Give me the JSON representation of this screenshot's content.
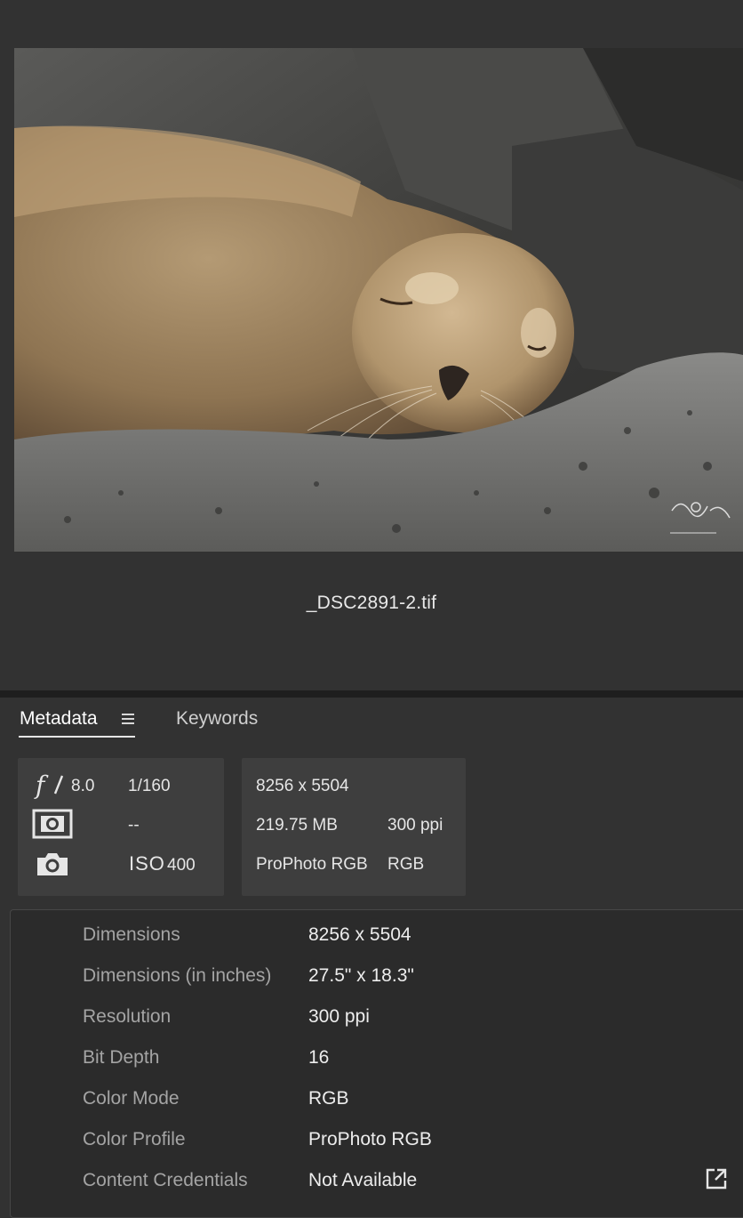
{
  "preview": {
    "filename": "_DSC2891-2.tif"
  },
  "tabs": {
    "metadata_label": "Metadata",
    "keywords_label": "Keywords"
  },
  "quick_info": {
    "aperture_value": "8.0",
    "shutter": "1/160",
    "metering": "--",
    "iso_label": "ISO",
    "iso_value": "400",
    "dimensions": "8256 x 5504",
    "file_size": "219.75 MB",
    "resolution": "300 ppi",
    "color_profile": "ProPhoto RGB",
    "color_mode": "RGB"
  },
  "metadata_rows": [
    {
      "label": "Dimensions",
      "value": "8256 x 5504"
    },
    {
      "label": "Dimensions (in inches)",
      "value": "27.5\" x 18.3\""
    },
    {
      "label": "Resolution",
      "value": "300 ppi"
    },
    {
      "label": "Bit Depth",
      "value": "16"
    },
    {
      "label": "Color Mode",
      "value": "RGB"
    },
    {
      "label": "Color Profile",
      "value": "ProPhoto RGB"
    },
    {
      "label": "Content Credentials",
      "value": "Not Available"
    }
  ],
  "icons": {
    "aperture": "aperture-icon",
    "metering": "metering-icon",
    "camera": "camera-icon",
    "menu": "menu-icon",
    "open_external": "open-external-icon"
  }
}
